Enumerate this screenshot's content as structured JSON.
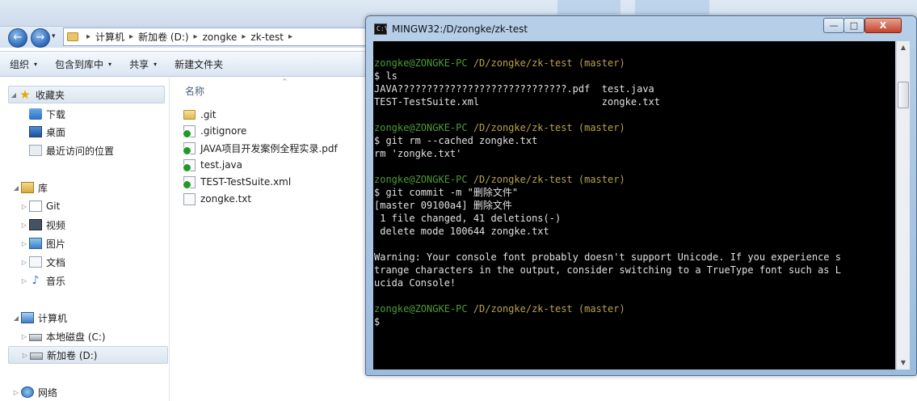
{
  "explorer": {
    "back_icon": "←",
    "forward_icon": "→",
    "dropdown_icon": "▾",
    "address": {
      "crumbs": [
        "计算机",
        "新加卷 (D:)",
        "zongke",
        "zk-test"
      ],
      "separator": "▸"
    },
    "toolbar": {
      "organize": "组织",
      "include_in_library": "包含到库中",
      "share": "共享",
      "new_folder": "新建文件夹",
      "caret": "▾"
    },
    "nav": {
      "favorites": "收藏夹",
      "downloads": "下载",
      "desktop": "桌面",
      "recent": "最近访问的位置",
      "libraries": "库",
      "git": "Git",
      "videos": "视频",
      "pictures": "图片",
      "documents": "文档",
      "music": "音乐",
      "computer": "计算机",
      "local_disk": "本地磁盘 (C:)",
      "new_volume": "新加卷 (D:)",
      "network": "网络",
      "expand_icon": "▷",
      "collapse_icon": "◢",
      "star_icon": "★",
      "music_icon": "♪"
    },
    "files": {
      "column_name": "名称",
      "sort_indicator": "^",
      "items": [
        {
          "name": ".git",
          "type": "folder"
        },
        {
          "name": ".gitignore",
          "type": "file-tracked"
        },
        {
          "name": "JAVA项目开发案例全程实录.pdf",
          "type": "file-tracked"
        },
        {
          "name": "test.java",
          "type": "file-tracked"
        },
        {
          "name": "TEST-TestSuite.xml",
          "type": "file-tracked"
        },
        {
          "name": "zongke.txt",
          "type": "file"
        }
      ]
    }
  },
  "terminal": {
    "title": "MINGW32:/D/zongke/zk-test",
    "app_icon_label": "C:\\",
    "minimize": "—",
    "maximize": "□",
    "close": "X",
    "scroll_up": "▲",
    "scroll_down": "▼",
    "prompt_user": "zongke@ZONGKE-PC",
    "prompt_path": "/D/zongke/zk-test (master)",
    "lines": [
      {
        "kind": "prompt"
      },
      {
        "kind": "text",
        "text": "$ ls"
      },
      {
        "kind": "text",
        "text": "JAVA?????????????????????????????.pdf  test.java"
      },
      {
        "kind": "text",
        "text": "TEST-TestSuite.xml                     zongke.txt"
      },
      {
        "kind": "blank"
      },
      {
        "kind": "prompt"
      },
      {
        "kind": "text",
        "text": "$ git rm --cached zongke.txt"
      },
      {
        "kind": "text",
        "text": "rm 'zongke.txt'"
      },
      {
        "kind": "blank"
      },
      {
        "kind": "prompt"
      },
      {
        "kind": "text",
        "text": "$ git commit -m \"删除文件\""
      },
      {
        "kind": "text",
        "text": "[master 09100a4] 删除文件"
      },
      {
        "kind": "text",
        "text": " 1 file changed, 41 deletions(-)"
      },
      {
        "kind": "text",
        "text": " delete mode 100644 zongke.txt"
      },
      {
        "kind": "blank"
      },
      {
        "kind": "text",
        "text": "Warning: Your console font probably doesn't support Unicode. If you experience s"
      },
      {
        "kind": "text",
        "text": "trange characters in the output, consider switching to a TrueType font such as L"
      },
      {
        "kind": "text",
        "text": "ucida Console!"
      },
      {
        "kind": "blank"
      },
      {
        "kind": "prompt"
      },
      {
        "kind": "text",
        "text": "$"
      }
    ]
  },
  "colors": {
    "prompt_user": "#4f9a37",
    "prompt_path": "#b8a24a",
    "terminal_bg": "#000000",
    "terminal_text": "#c0c0c0"
  }
}
